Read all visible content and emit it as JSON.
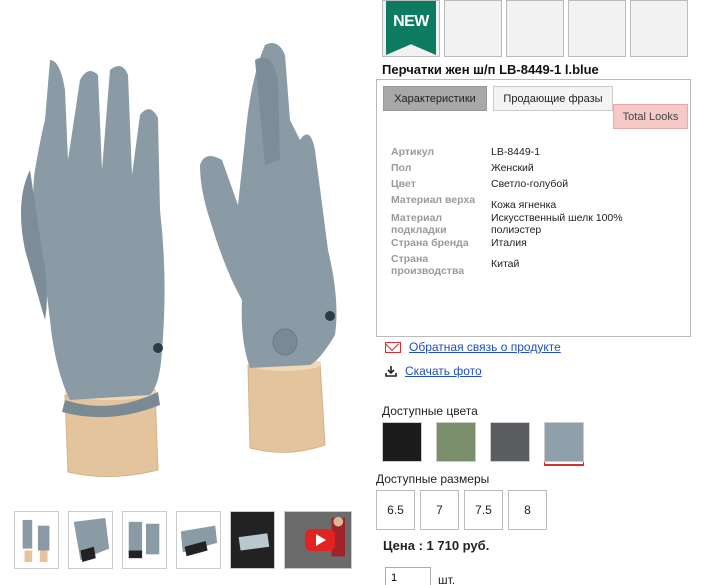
{
  "badges": {
    "new_label": "NEW"
  },
  "product": {
    "title": "Перчатки жен ш/п LB-8449-1 l.blue"
  },
  "tabs": [
    {
      "label": "Характеристики"
    },
    {
      "label": "Продающие фразы"
    },
    {
      "label": "Total Looks"
    }
  ],
  "attributes": [
    {
      "key": "Артикул",
      "value": "LB-8449-1"
    },
    {
      "key": "Пол",
      "value": "Женский"
    },
    {
      "key": "Цвет",
      "value": "Светло-голубой"
    },
    {
      "key": "Материал верха",
      "value": "Кожа ягненка"
    },
    {
      "key": "Материал подкладки",
      "value": "Искусственный шелк 100% полиэстер"
    },
    {
      "key": "Страна бренда",
      "value": "Италия"
    },
    {
      "key": "Страна производства",
      "value": "Китай"
    }
  ],
  "links": {
    "feedback": "Обратная связь о продукте",
    "download": "Скачать фото"
  },
  "colors": {
    "label": "Доступные цвета",
    "swatches": [
      {
        "name": "black",
        "hex": "#1b1b1b"
      },
      {
        "name": "green",
        "hex": "#7c8f6c"
      },
      {
        "name": "dark-grey",
        "hex": "#5b5d60"
      },
      {
        "name": "light-blue",
        "hex": "#8fa0aa",
        "selected": true
      }
    ]
  },
  "sizes": {
    "label": "Доступные размеры",
    "options": [
      "6.5",
      "7",
      "7.5",
      "8"
    ]
  },
  "price": {
    "text": "Цена : 1 710 руб."
  },
  "quantity": {
    "value": "1",
    "unit": "шт."
  },
  "glove_color": "#8b9ba5",
  "stand_color": "#e3c49c"
}
